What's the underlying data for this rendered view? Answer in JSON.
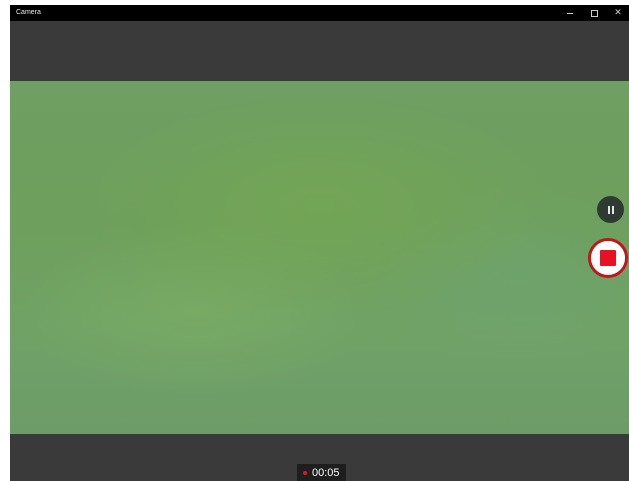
{
  "window": {
    "title": "Camera",
    "controls": {
      "minimize_icon": "minimize-icon",
      "maximize_icon": "maximize-icon",
      "close_label": "✕"
    }
  },
  "camera": {
    "mode": "video-recording",
    "pause_icon": "pause-icon",
    "stop_icon": "stop-record-icon",
    "recording_timer": "00:05",
    "recording_indicator_color": "#e81123",
    "record_ring_color": "#c0171c"
  }
}
